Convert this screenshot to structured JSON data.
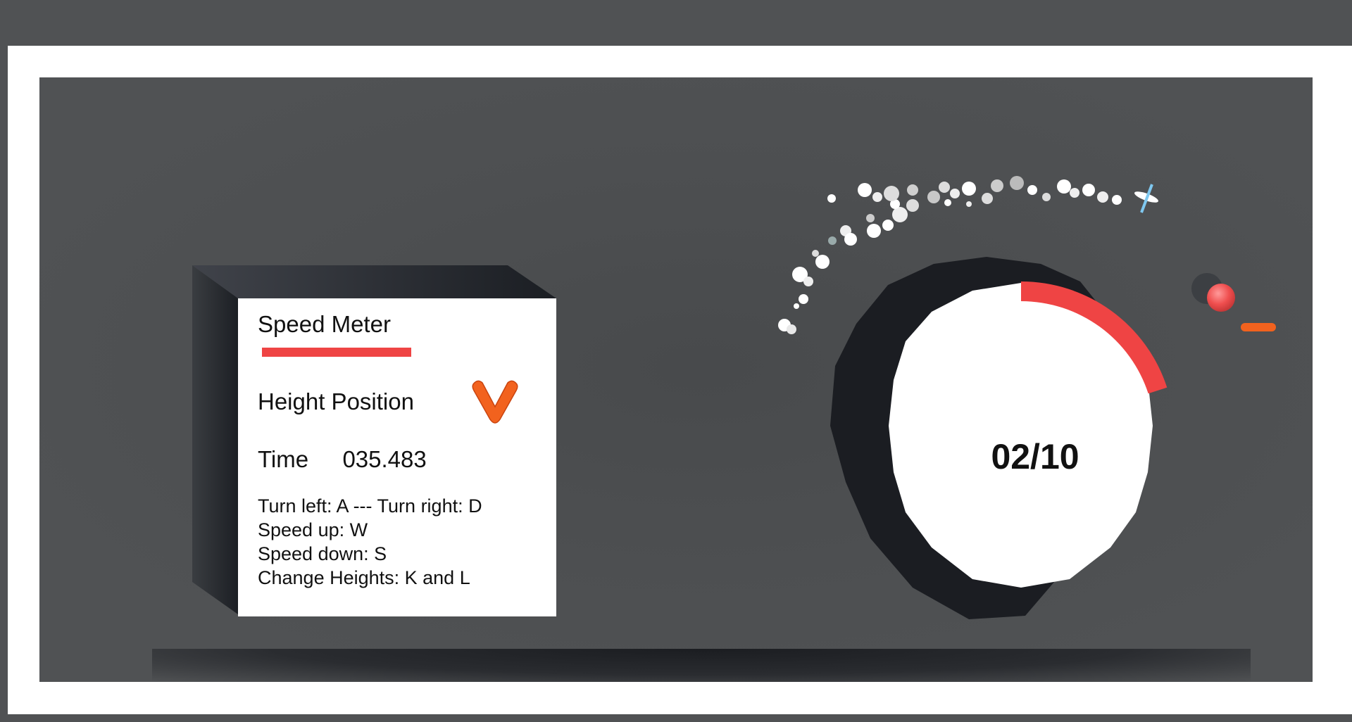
{
  "panel": {
    "speed_label": "Speed Meter",
    "speed_level": 0.47,
    "height_label": "Height Position",
    "height_icon": "v-chevron-icon",
    "time_label": "Time",
    "time_value": "035.483",
    "controls": [
      "Turn left: A --- Turn right: D",
      "Speed up: W",
      "Speed down: S",
      "Change Heights: K and L"
    ]
  },
  "dial": {
    "lap_text": "02/10",
    "progress": 0.2
  },
  "colors": {
    "accent_red": "#ef4444",
    "accent_orange": "#f2621e",
    "panel_bg": "#ffffff",
    "scene_bg": "#4d4f51",
    "shadow": "#1b1d22"
  }
}
